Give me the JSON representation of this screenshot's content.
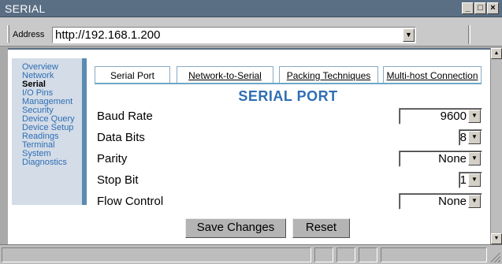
{
  "window": {
    "title": "SERIAL"
  },
  "address_bar": {
    "label": "Address",
    "url": "http://192.168.1.200"
  },
  "sidebar": {
    "items": [
      {
        "label": "Overview",
        "active": false
      },
      {
        "label": "Network",
        "active": false
      },
      {
        "label": "Serial",
        "active": true
      },
      {
        "label": "I/O Pins",
        "active": false
      },
      {
        "label": "Management",
        "active": false
      },
      {
        "label": "Security",
        "active": false
      },
      {
        "label": "Device Query",
        "active": false
      },
      {
        "label": "Device Setup",
        "active": false
      },
      {
        "label": "Readings",
        "active": false
      },
      {
        "label": "Terminal",
        "active": false
      },
      {
        "label": "System",
        "active": false
      },
      {
        "label": "Diagnostics",
        "active": false
      }
    ]
  },
  "tabs": [
    {
      "label": "Serial Port",
      "active": true
    },
    {
      "label": "Network-to-Serial",
      "active": false
    },
    {
      "label": "Packing Techniques",
      "active": false
    },
    {
      "label": "Multi-host Connection",
      "active": false
    }
  ],
  "main": {
    "title": "SERIAL PORT",
    "fields": {
      "baud_rate": {
        "label": "Baud Rate",
        "value": "9600"
      },
      "data_bits": {
        "label": "Data Bits",
        "value": "8"
      },
      "parity": {
        "label": "Parity",
        "value": "None"
      },
      "stop_bit": {
        "label": "Stop Bit",
        "value": "1"
      },
      "flow_control": {
        "label": "Flow Control",
        "value": "None"
      }
    },
    "buttons": {
      "save": "Save Changes",
      "reset": "Reset"
    }
  },
  "icons": {
    "minimize": "minimize-icon",
    "maximize": "maximize-icon",
    "close": "close-icon",
    "dropdown": "chevron-down-icon",
    "scroll_up": "scroll-up-icon",
    "scroll_down": "scroll-down-icon"
  },
  "colors": {
    "titlebar": "#5a6e84",
    "accent_blue": "#2f6eb5",
    "sidebar_bg": "#d3dce7",
    "sidebar_border": "#5b8bb2",
    "tab_underline": "#6fa6c7"
  }
}
